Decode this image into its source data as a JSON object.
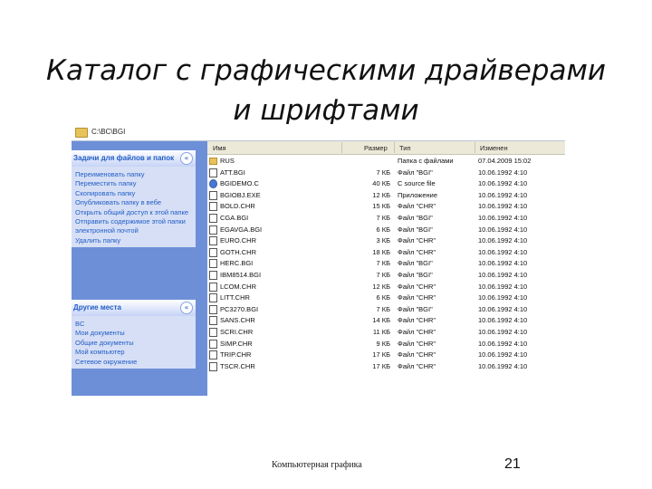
{
  "slide": {
    "title_line1": "Каталог с графическими драйверами",
    "title_line2": "и шрифтами",
    "footer": "Компьютерная графика",
    "page_number": "21"
  },
  "window": {
    "address": "C:\\BC\\BGI"
  },
  "tasks": {
    "header": "Задачи для файлов и папок",
    "items": [
      "Переименовать папку",
      "Переместить папку",
      "Скопировать папку",
      "Опубликовать папку в вебе",
      "Открыть общий доступ к этой папке",
      "Отправить содержимое этой папки электронной почтой",
      "Удалить папку"
    ]
  },
  "places": {
    "header": "Другие места",
    "items": [
      "BC",
      "Мои документы",
      "Общие документы",
      "Мой компьютер",
      "Сетевое окружение"
    ]
  },
  "file_list": {
    "columns": [
      "Имя",
      "Размер",
      "Тип",
      "Изменен"
    ],
    "rows": [
      {
        "name": "RUS",
        "size": "",
        "type": "Папка с файлами",
        "date": "07.04.2009 15:02",
        "icon": "folder"
      },
      {
        "name": "ATT.BGI",
        "size": "7 КБ",
        "type": "Файл \"BGI\"",
        "date": "10.06.1992 4:10",
        "icon": "file"
      },
      {
        "name": "BGIDEMO.C",
        "size": "40 КБ",
        "type": "C source file",
        "date": "10.06.1992 4:10",
        "icon": "globe"
      },
      {
        "name": "BGIOBJ.EXE",
        "size": "12 КБ",
        "type": "Приложение",
        "date": "10.06.1992 4:10",
        "icon": "file"
      },
      {
        "name": "BOLD.CHR",
        "size": "15 КБ",
        "type": "Файл \"CHR\"",
        "date": "10.06.1992 4:10",
        "icon": "file"
      },
      {
        "name": "CGA.BGI",
        "size": "7 КБ",
        "type": "Файл \"BGI\"",
        "date": "10.06.1992 4:10",
        "icon": "file"
      },
      {
        "name": "EGAVGA.BGI",
        "size": "6 КБ",
        "type": "Файл \"BGI\"",
        "date": "10.06.1992 4:10",
        "icon": "file"
      },
      {
        "name": "EURO.CHR",
        "size": "3 КБ",
        "type": "Файл \"CHR\"",
        "date": "10.06.1992 4:10",
        "icon": "file"
      },
      {
        "name": "GOTH.CHR",
        "size": "18 КБ",
        "type": "Файл \"CHR\"",
        "date": "10.06.1992 4:10",
        "icon": "file"
      },
      {
        "name": "HERC.BGI",
        "size": "7 КБ",
        "type": "Файл \"BGI\"",
        "date": "10.06.1992 4:10",
        "icon": "file"
      },
      {
        "name": "IBM8514.BGI",
        "size": "7 КБ",
        "type": "Файл \"BGI\"",
        "date": "10.06.1992 4:10",
        "icon": "file"
      },
      {
        "name": "LCOM.CHR",
        "size": "12 КБ",
        "type": "Файл \"CHR\"",
        "date": "10.06.1992 4:10",
        "icon": "file"
      },
      {
        "name": "LITT.CHR",
        "size": "6 КБ",
        "type": "Файл \"CHR\"",
        "date": "10.06.1992 4:10",
        "icon": "file"
      },
      {
        "name": "PC3270.BGI",
        "size": "7 КБ",
        "type": "Файл \"BGI\"",
        "date": "10.06.1992 4:10",
        "icon": "file"
      },
      {
        "name": "SANS.CHR",
        "size": "14 КБ",
        "type": "Файл \"CHR\"",
        "date": "10.06.1992 4:10",
        "icon": "file"
      },
      {
        "name": "SCRI.CHR",
        "size": "11 КБ",
        "type": "Файл \"CHR\"",
        "date": "10.06.1992 4:10",
        "icon": "file"
      },
      {
        "name": "SIMP.CHR",
        "size": "9 КБ",
        "type": "Файл \"CHR\"",
        "date": "10.06.1992 4:10",
        "icon": "file"
      },
      {
        "name": "TRIP.CHR",
        "size": "17 КБ",
        "type": "Файл \"CHR\"",
        "date": "10.06.1992 4:10",
        "icon": "file"
      },
      {
        "name": "TSCR.CHR",
        "size": "17 КБ",
        "type": "Файл \"CHR\"",
        "date": "10.06.1992 4:10",
        "icon": "file"
      }
    ]
  }
}
